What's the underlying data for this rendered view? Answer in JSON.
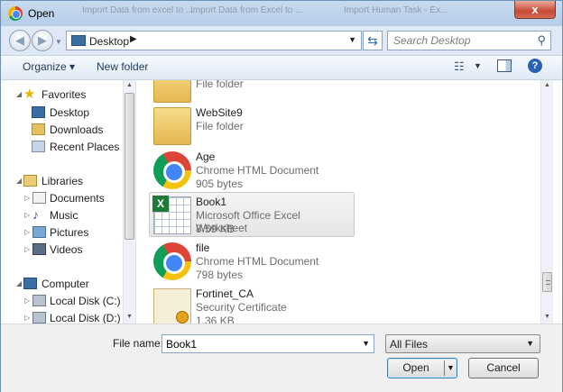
{
  "window": {
    "title": "Open",
    "close_label": "x"
  },
  "background_tabs": [
    "Import Data from excel to ...",
    "Import Data from Excel to ...",
    "Import Human Task - Ex..."
  ],
  "nav": {
    "location": "Desktop",
    "search_placeholder": "Search Desktop"
  },
  "toolbar": {
    "organize": "Organize",
    "new_folder": "New folder"
  },
  "tree": {
    "favorites": {
      "label": "Favorites",
      "items": [
        "Desktop",
        "Downloads",
        "Recent Places"
      ]
    },
    "libraries": {
      "label": "Libraries",
      "items": [
        "Documents",
        "Music",
        "Pictures",
        "Videos"
      ]
    },
    "computer": {
      "label": "Computer",
      "items": [
        "Local Disk (C:)",
        "Local Disk (D:)"
      ]
    }
  },
  "files": [
    {
      "name": "",
      "type": "File folder",
      "size": "",
      "icon": "folder-icon"
    },
    {
      "name": "WebSite9",
      "type": "File folder",
      "size": "",
      "icon": "folder-icon"
    },
    {
      "name": "Age",
      "type": "Chrome HTML Document",
      "size": "905 bytes",
      "icon": "chrome-icon"
    },
    {
      "name": "Book1",
      "type": "Microsoft Office Excel Worksheet",
      "size": "8.59 KB",
      "icon": "excel-icon",
      "selected": true
    },
    {
      "name": "file",
      "type": "Chrome HTML Document",
      "size": "798 bytes",
      "icon": "chrome-icon"
    },
    {
      "name": "Fortinet_CA",
      "type": "Security Certificate",
      "size": "1.36 KB",
      "icon": "certificate-icon"
    }
  ],
  "bottom": {
    "file_name_label": "File name:",
    "file_name_value": "Book1",
    "file_type": "All Files",
    "open_label": "Open",
    "cancel_label": "Cancel"
  }
}
